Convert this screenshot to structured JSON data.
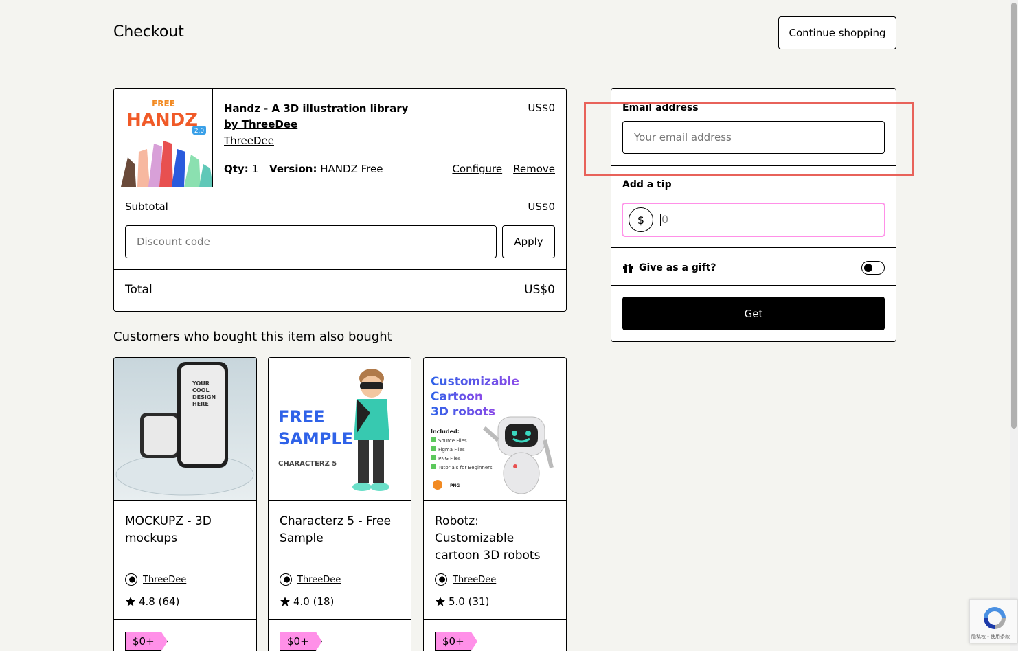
{
  "header": {
    "title": "Checkout",
    "continue_label": "Continue shopping"
  },
  "cart": {
    "item": {
      "title": "Handz - A 3D illustration library by ThreeDee",
      "creator": "ThreeDee",
      "price": "US$0",
      "qty_label": "Qty:",
      "qty_value": "1",
      "version_label": "Version:",
      "version_value": "HANDZ Free",
      "configure_label": "Configure",
      "remove_label": "Remove",
      "thumb_badge": "FREE",
      "thumb_name": "HANDZ",
      "thumb_version": "2.0"
    },
    "subtotal_label": "Subtotal",
    "subtotal_value": "US$0",
    "discount_placeholder": "Discount code",
    "apply_label": "Apply",
    "total_label": "Total",
    "total_value": "US$0"
  },
  "panel": {
    "email_label": "Email address",
    "email_placeholder": "Your email address",
    "tip_label": "Add a tip",
    "tip_currency": "$",
    "tip_value": "0",
    "gift_label": "Give as a gift?",
    "get_label": "Get"
  },
  "recommendations": {
    "heading": "Customers who bought this item also bought",
    "items": [
      {
        "title": "MOCKUPZ - 3D mockups",
        "creator": "ThreeDee",
        "rating": "4.8 (64)",
        "price": "$0+",
        "img_text": "YOUR COOL DESIGN HERE"
      },
      {
        "title": "Characterz 5 - Free Sample",
        "creator": "ThreeDee",
        "rating": "4.0 (18)",
        "price": "$0+",
        "img_line1": "FREE",
        "img_line2": "SAMPLE",
        "img_line3": "CHARACTERZ 5"
      },
      {
        "title": "Robotz: Customizable cartoon 3D robots",
        "creator": "ThreeDee",
        "rating": "5.0 (31)",
        "price": "$0+",
        "img_line1": "Customizable",
        "img_line2": "Cartoon",
        "img_line3": "3D robots",
        "img_included": "Included:",
        "img_list": [
          "Source Files",
          "Figma Files",
          "PNG Files",
          "Tutorials for Beginners"
        ],
        "img_png": "PNG"
      }
    ]
  },
  "recaptcha": {
    "text": "隐私权 - 使用条款"
  },
  "colors": {
    "accent_pink": "#ff90e8",
    "highlight": "#e8625a",
    "background": "#f4f4f0"
  }
}
